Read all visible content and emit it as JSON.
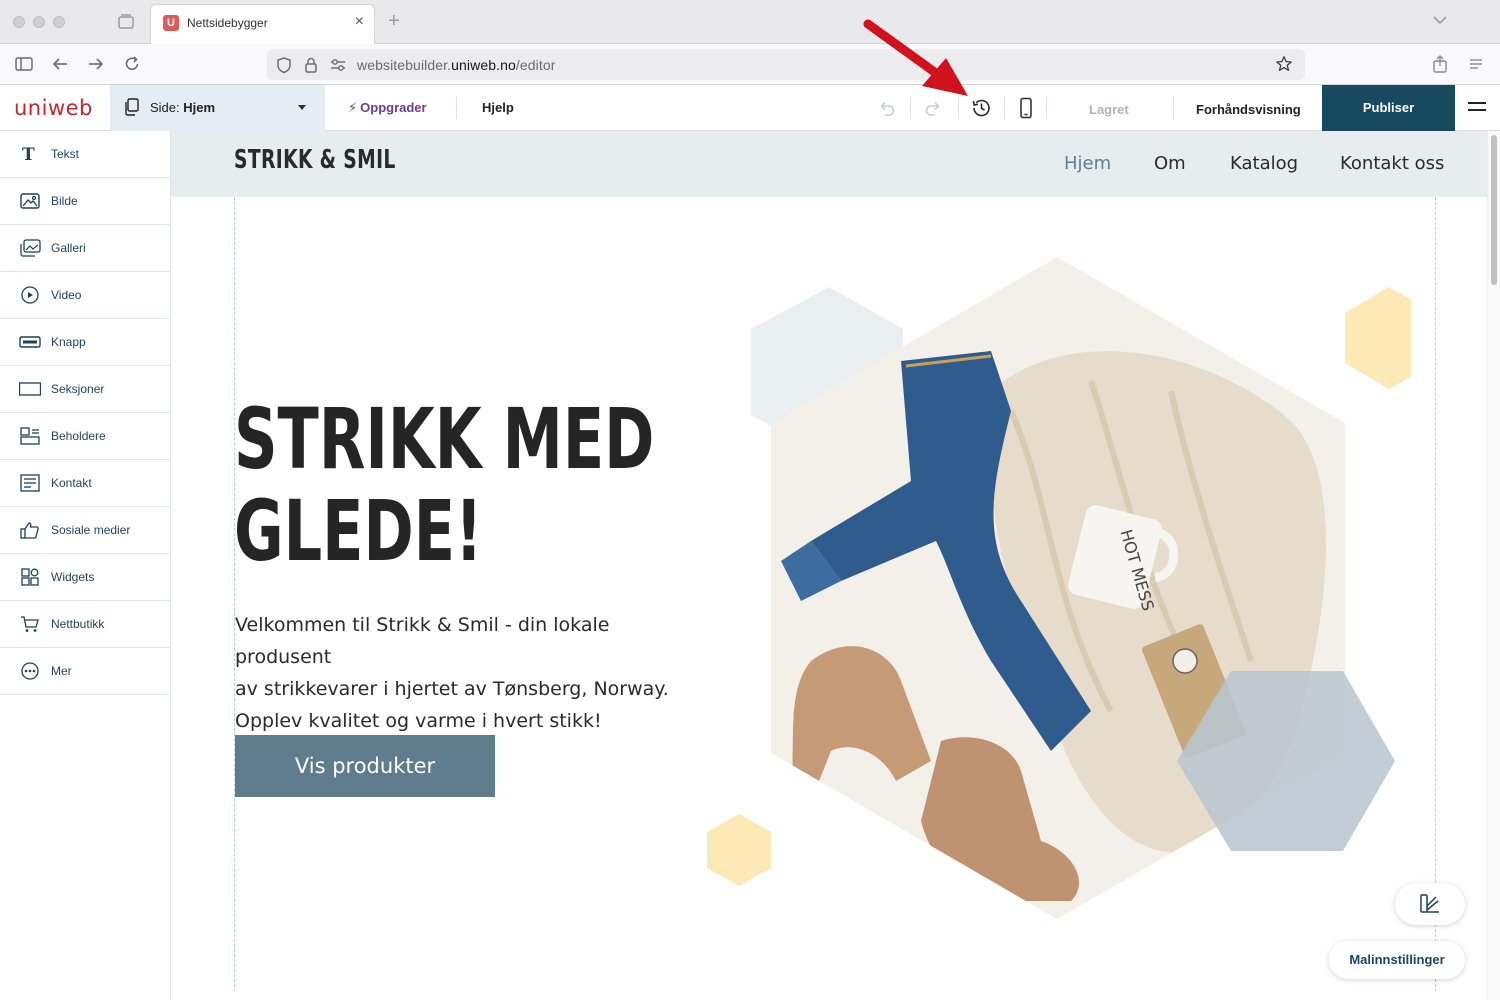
{
  "browser": {
    "tab_title": "Nettsidebygger",
    "tab_favicon": "U",
    "new_tab_glyph": "+",
    "close_glyph": "×",
    "url_prefix": "websitebuilder.",
    "url_domain": "uniweb.no",
    "url_path": "/editor"
  },
  "toolbar": {
    "logo": "uniweb",
    "page_label": "Side:",
    "page_name": "Hjem",
    "upgrade_label": "Oppgrader",
    "help_label": "Hjelp",
    "saved_label": "Lagret",
    "preview_label": "Forhåndsvisning",
    "publish_label": "Publiser",
    "icons": [
      "undo-icon",
      "redo-icon",
      "history-icon",
      "mobile-preview-icon",
      "menu-icon"
    ]
  },
  "sidebar": {
    "items": [
      {
        "label": "Tekst",
        "icon": "text-icon"
      },
      {
        "label": "Bilde",
        "icon": "image-icon"
      },
      {
        "label": "Galleri",
        "icon": "gallery-icon"
      },
      {
        "label": "Video",
        "icon": "video-icon"
      },
      {
        "label": "Knapp",
        "icon": "button-icon"
      },
      {
        "label": "Seksjoner",
        "icon": "section-icon"
      },
      {
        "label": "Beholdere",
        "icon": "container-icon"
      },
      {
        "label": "Kontakt",
        "icon": "contact-form-icon"
      },
      {
        "label": "Sosiale medier",
        "icon": "thumbs-up-icon"
      },
      {
        "label": "Widgets",
        "icon": "widgets-icon"
      },
      {
        "label": "Nettbutikk",
        "icon": "cart-icon"
      },
      {
        "label": "Mer",
        "icon": "more-icon"
      }
    ]
  },
  "site": {
    "logo": "STRIKK & SMIL",
    "nav": [
      "Hjem",
      "Om",
      "Katalog",
      "Kontakt oss"
    ],
    "active_nav": "Hjem",
    "hero_title_line1": "STRIKK MED",
    "hero_title_line2": "GLEDE!",
    "hero_text_line1": "Velkommen til Strikk & Smil - din lokale produsent",
    "hero_text_line2": "av strikkevarer i hjertet av Tønsberg, Norway.",
    "hero_text_line3": "Opplev kvalitet og varme i hvert stikk!",
    "hero_button": "Vis produkter",
    "mug_text": "HOT MESS"
  },
  "floating": {
    "design_icon": "design-edit-icon",
    "template_settings_label": "Malinnstillinger"
  },
  "colors": {
    "brand_red": "#c2262e",
    "publish_bg": "#17495f",
    "upgrade_purple": "#6b3a93",
    "hero_button_bg": "#5e7c8c",
    "header_bg": "#e7ecef",
    "hex_yellow": "#fde9b6",
    "hex_blue_gray": "#b9c6cf",
    "annotation_arrow": "#d0121f"
  }
}
